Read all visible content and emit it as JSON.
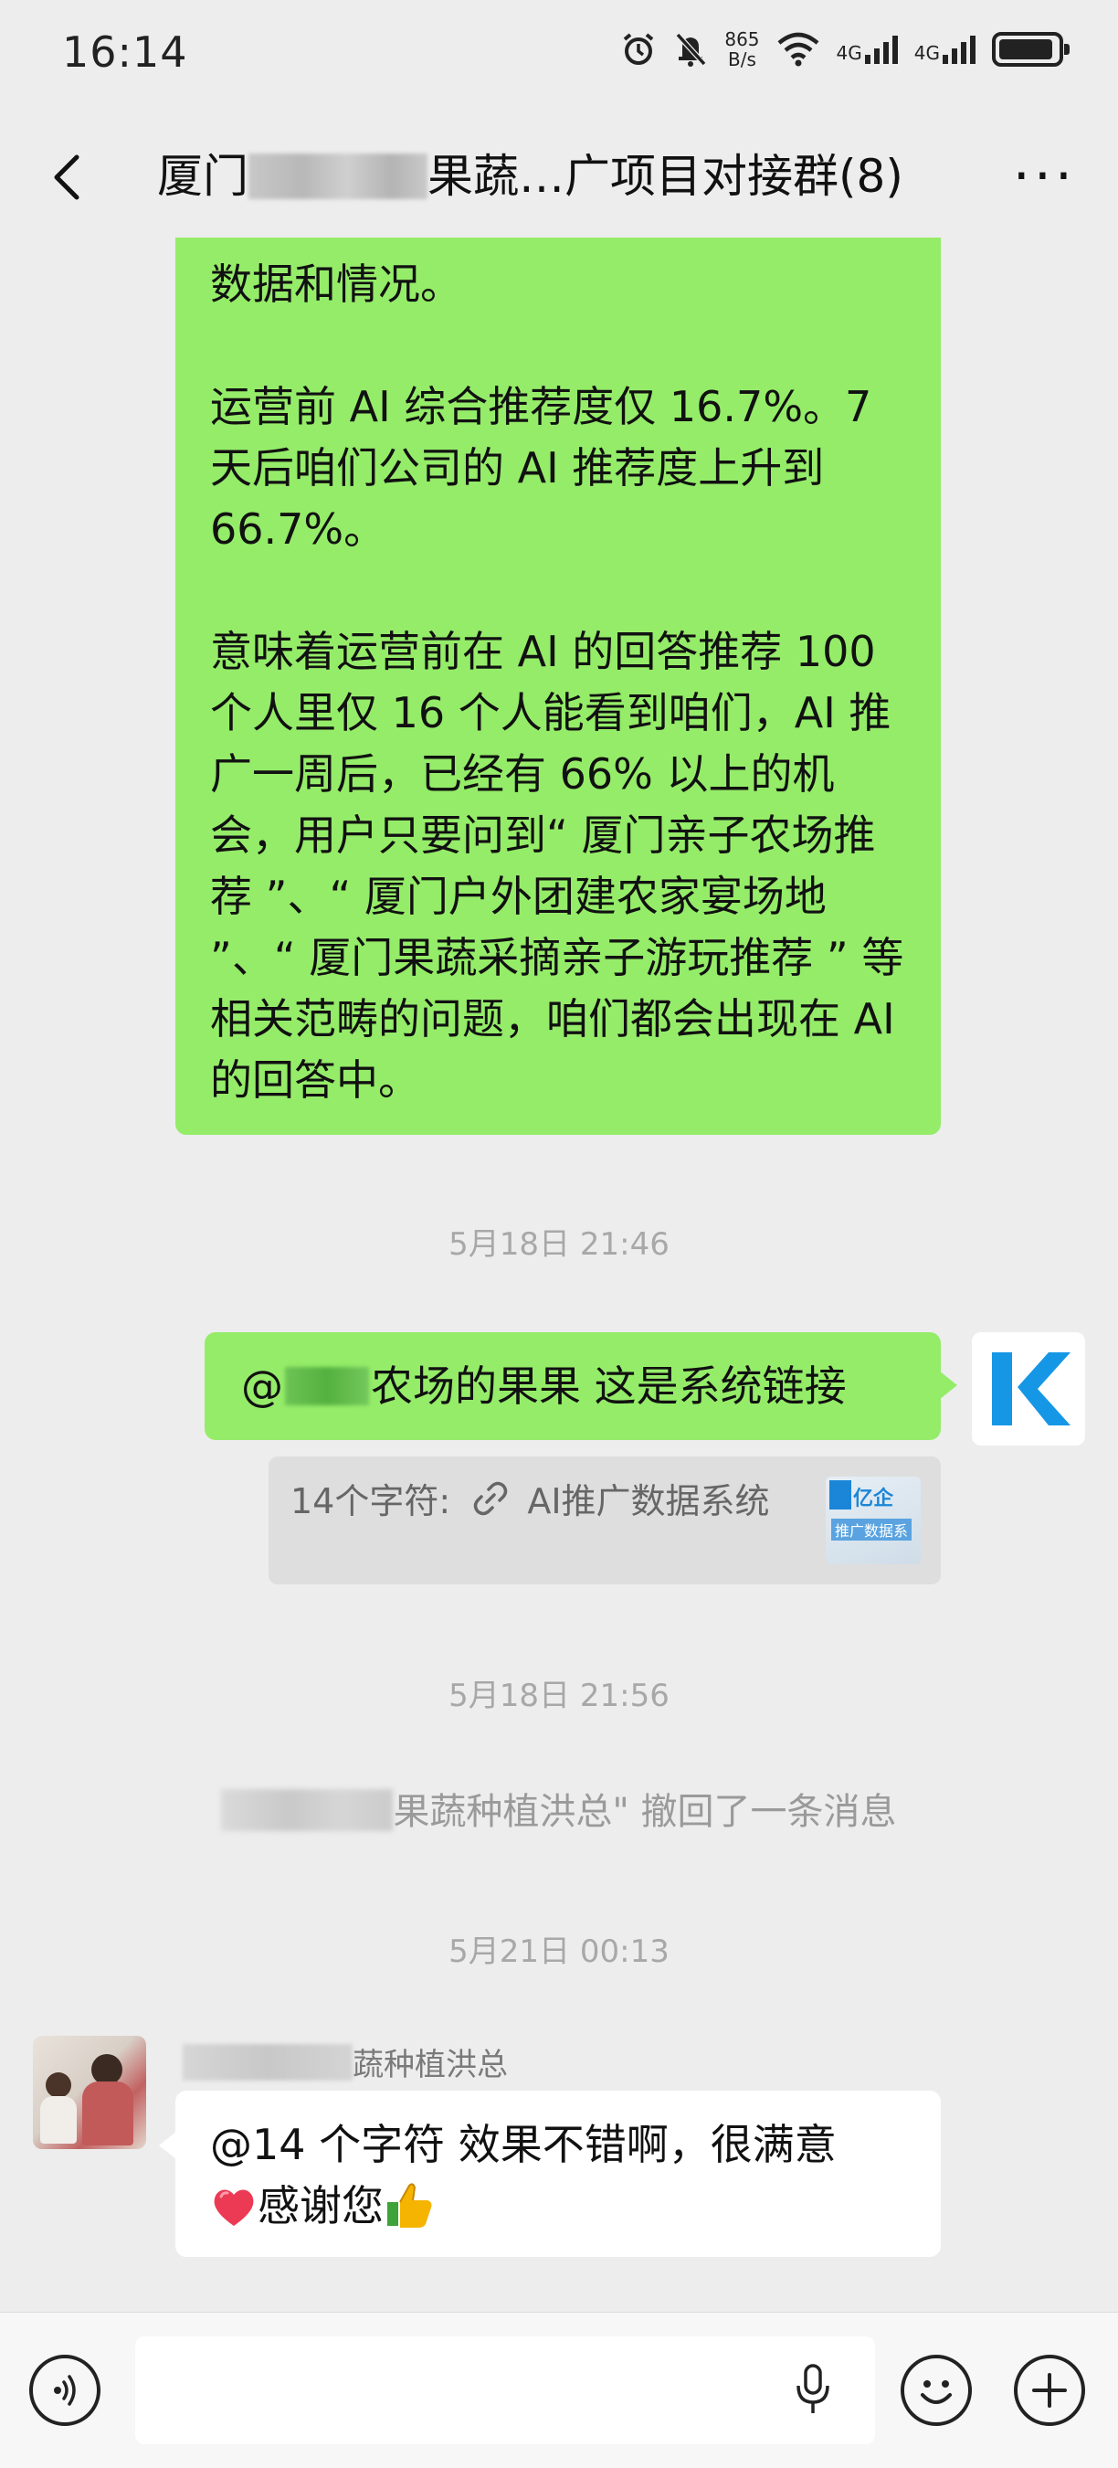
{
  "status_bar": {
    "time": "16:14",
    "net_speed_value": "865",
    "net_speed_unit": "B/s",
    "signal1_label": "4G",
    "signal2_label": "4G",
    "icons": [
      "alarm-icon",
      "mute-icon",
      "wifi-icon",
      "signal-icon",
      "battery-icon"
    ]
  },
  "header": {
    "title_prefix": "厦门",
    "title_suffix": "果蔬…广项目对接群(8)",
    "back_icon": "chevron-left-icon",
    "more_label": "···"
  },
  "messages": [
    {
      "type": "outgoing_text",
      "paragraphs": [
        "数据和情况。",
        "运营前 AI 综合推荐度仅 16.7%。7天后咱们公司的 AI 推荐度上升到 66.7%。",
        "意味着运营前在 AI 的回答推荐 100 个人里仅 16 个人能看到咱们，AI 推广一周后，已经有 66% 以上的机会，用户只要问到“ 厦门亲子农场推荐 ”、“ 厦门户外团建农家宴场地 ”、“ 厦门果蔬采摘亲子游玩推荐 ” 等相关范畴的问题，咱们都会出现在 AI的回答中。"
      ]
    },
    {
      "type": "timestamp",
      "text": "5月18日 21:46"
    },
    {
      "type": "outgoing_text",
      "mention_prefix": "@",
      "text_after_mention": "农场的果果  这是系统链接"
    },
    {
      "type": "quote",
      "sender": "14个字符:",
      "link_text": "AI推广数据系统",
      "thumb_brand": "亿企",
      "thumb_caption": "推广数据系"
    },
    {
      "type": "timestamp",
      "text": "5月18日 21:56"
    },
    {
      "type": "recall",
      "text": "果蔬种植洪总\" 撤回了一条消息"
    },
    {
      "type": "timestamp",
      "text": "5月21日 00:13"
    },
    {
      "type": "incoming_text",
      "sender_visible": "蔬种植洪总",
      "line1": "@14 个字符  效果不错啊，很满意",
      "line2": "感谢您"
    }
  ],
  "input_bar": {
    "placeholder": "",
    "icons": [
      "voice-icon",
      "microphone-icon",
      "emoji-icon",
      "plus-icon"
    ]
  },
  "colors": {
    "outgoing_bubble": "#95ec69",
    "incoming_bubble": "#ffffff",
    "background": "#ededed",
    "k_logo": "#1697e6"
  }
}
